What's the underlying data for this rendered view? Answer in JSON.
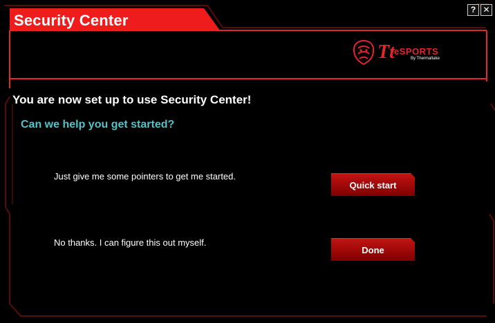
{
  "window": {
    "title": "Security Center",
    "help_glyph": "?",
    "close_glyph": "✕"
  },
  "logo": {
    "mark": "Tt",
    "brand": "eSPORTS",
    "tagline": "By Thermaltake"
  },
  "content": {
    "heading": "You are now set up to use Security Center!",
    "subheading": "Can we help you get started?",
    "options": [
      {
        "text": "Just give me some pointers to get me started.",
        "button": "Quick start"
      },
      {
        "text": "No thanks. I can figure this out myself.",
        "button": "Done"
      }
    ]
  },
  "colors": {
    "accent_red": "#e3262b",
    "subheading_teal": "#52c3c9",
    "background": "#000000"
  }
}
